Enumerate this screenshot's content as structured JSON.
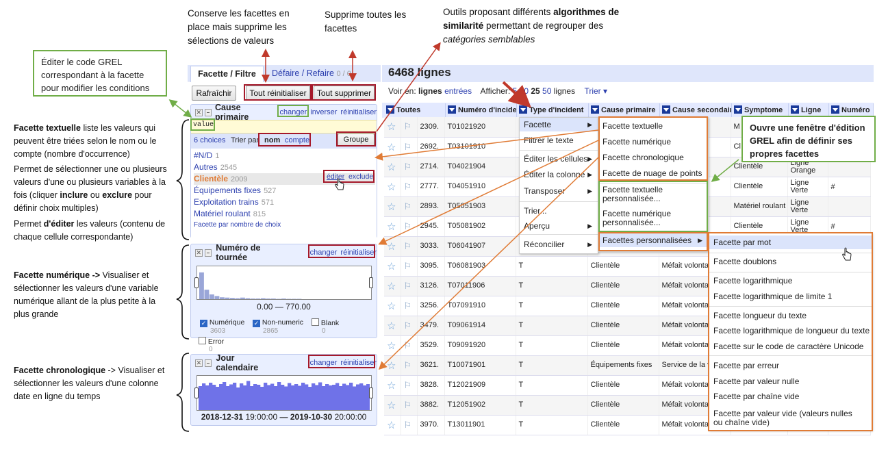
{
  "annotations": {
    "keep_facets": "Conserve les facettes en place mais supprime les sélections de valeurs",
    "remove_all": "Supprime toutes les facettes",
    "tools_1": "Outils proposant différents ",
    "tools_bold": "algorithmes de similarité",
    "tools_2": " permettant de regrouper des ",
    "tools_ital": "catégories semblables",
    "edit_grel": "Éditer le code GREL correspondant à la facette pour modifier les conditions",
    "text_bold": "Facette textuelle",
    "text_1": " liste les valeurs qui peuvent être triées selon le nom ou le compte (nombre d'occurrence)",
    "text_2a": "Permet de sélectionner une ou plusieurs valeurs d'une ou plusieurs variables à la fois (cliquer ",
    "text_2b": "inclure",
    "text_2c": " ou ",
    "text_2d": "exclure",
    "text_2e": " pour définir choix multiples)",
    "text_3a": "Permet ",
    "text_3b": "d'éditer",
    "text_3c": " les valeurs (contenu de chaque cellule correspondante)",
    "num_bold": "Facette numérique ->",
    "num_rest": " Visualiser et sélectionner les valeurs d'une variable numérique allant de la plus petite à la plus grande",
    "chrono_bold": "Facette chronologique",
    "chrono_rest": " ->  Visualiser et sélectionner les valeurs d'une colonne date en ligne du temps",
    "grel_window": "Ouvre une fenêtre d'édition GREL afin de définir ses propres facettes"
  },
  "tabs": {
    "facet": "Facette / Filtre",
    "undo": "Défaire / Refaire",
    "undo_count": "0 / 0"
  },
  "buttons": {
    "refresh": "Rafraîchir",
    "reset_all": "Tout réinitialiser",
    "remove_all": "Tout supprimer"
  },
  "facet1": {
    "title": "Cause primaire",
    "change": "changer",
    "invert": "inverser",
    "reset": "réinitialiser",
    "expr": "value",
    "choices": "6 choices",
    "sortby": "Trier par",
    "sort_name": "nom",
    "sort_count": "compte",
    "group": "Groupe",
    "items": [
      {
        "name": "#N/D",
        "count": "1"
      },
      {
        "name": "Autres",
        "count": "2545"
      },
      {
        "name": "Clientèle",
        "count": "2009"
      },
      {
        "name": "Équipements fixes",
        "count": "527"
      },
      {
        "name": "Exploitation trains",
        "count": "571"
      },
      {
        "name": "Matériel roulant",
        "count": "815"
      }
    ],
    "edit": "éditer",
    "exclude": "exclude",
    "by_count": "Facette par nombre de choix"
  },
  "facet2": {
    "title": "Numéro de tournée",
    "change": "changer",
    "reset": "réinitialiser",
    "range": "0.00 — 770.00",
    "numeric": "Numérique",
    "numeric_n": "3603",
    "nonnumeric": "Non-numeric",
    "nonnumeric_n": "2865",
    "blank": "Blank",
    "blank_n": "0",
    "error": "Error",
    "error_n": "0"
  },
  "facet3": {
    "title": "Jour calendaire",
    "change": "changer",
    "reset": "réinitialiser",
    "from": "2018-12-31",
    "from_t": "19:00:00",
    "dash": "—",
    "to": "2019-10-30",
    "to_t": "20:00:00"
  },
  "grid": {
    "rows_title": "6468 lignes",
    "view_label": "Voir en:",
    "view_rows": "lignes",
    "view_records": "entrées",
    "show_label": "Afficher:",
    "show_5": "5",
    "show_10": "10",
    "show_25": "25",
    "show_50": "50",
    "show_unit": "lignes",
    "sort": "Trier",
    "cols": [
      "Toutes",
      "Numéro d'incident",
      "Type d'incident",
      "Cause primaire",
      "Cause secondaire",
      "Symptome",
      "Ligne",
      "Numéro"
    ],
    "rows": [
      [
        "2309.",
        "T01021920",
        "",
        "",
        "oie",
        "M",
        ""
      ],
      [
        "2692.",
        "T03101910",
        "",
        "",
        "re",
        "Cl",
        ""
      ],
      [
        "2714.",
        "T04021904",
        "",
        "",
        "re",
        "Clientèle",
        "Ligne Orange"
      ],
      [
        "2777.",
        "T04051910",
        "",
        "",
        "re",
        "Clientèle",
        "Ligne Verte"
      ],
      [
        "2893.",
        "T05051903",
        "",
        "",
        "re",
        "Matériel roulant",
        "Ligne Verte"
      ],
      [
        "2945.",
        "T05081902",
        "",
        "",
        "re",
        "Clientèle",
        "Ligne Verte"
      ],
      [
        "3033.",
        "T06041907",
        "",
        "",
        "",
        "",
        ""
      ],
      [
        "3095.",
        "T06081903",
        "T",
        "Clientèle",
        "Méfait volontai",
        "",
        ""
      ],
      [
        "3126.",
        "T07011906",
        "T",
        "Clientèle",
        "Méfait volontai",
        "",
        ""
      ],
      [
        "3256.",
        "T07091910",
        "T",
        "Clientèle",
        "Méfait volontai",
        "",
        ""
      ],
      [
        "3479.",
        "T09061914",
        "T",
        "Clientèle",
        "Méfait volontai",
        "",
        ""
      ],
      [
        "3529.",
        "T09091920",
        "T",
        "Clientèle",
        "Méfait volontai",
        "",
        ""
      ],
      [
        "3621.",
        "T10071901",
        "T",
        "Équipements fixes",
        "Service de la v",
        "",
        ""
      ],
      [
        "3828.",
        "T12021909",
        "T",
        "Clientèle",
        "Méfait volontai",
        "",
        ""
      ],
      [
        "3882.",
        "T12051902",
        "T",
        "Clientèle",
        "Méfait volontai",
        "",
        ""
      ],
      [
        "3970.",
        "T13011901",
        "T",
        "Clientèle",
        "Méfait volontai",
        "",
        ""
      ]
    ],
    "hash": "#"
  },
  "menu1": [
    "Facette",
    "Filtrer le texte",
    "Éditer les cellules",
    "Éditer la colonne",
    "Transposer",
    "Trier...",
    "Aperçu",
    "Réconcilier"
  ],
  "menu2": [
    "Facette textuelle",
    "Facette numérique",
    "Facette chronologique",
    "Facette de nuage de points",
    "Facette textuelle personnalisée...",
    "Facette numérique personnalisée...",
    "Facettes personnalisées"
  ],
  "menu3": [
    "Facette par mot",
    "Facette doublons",
    "Facette logarithmique",
    "Facette logarithmique de limite 1",
    "Facette longueur du texte",
    "Facette logarithmique de longueur du texte",
    "Facette sur le code de caractère Unicode",
    "Facette par erreur",
    "Facette par valeur nulle",
    "Facette par chaîne vide",
    "Facette par valeur vide (valeurs nulles ou chaîne vide)"
  ],
  "histogram": [
    0.85,
    0.3,
    0.15,
    0.1,
    0.06,
    0.05,
    0.04,
    0.03,
    0.05,
    0.03,
    0.02,
    0.02,
    0.03,
    0.02,
    0.02,
    0.01,
    0.02,
    0.01,
    0.01,
    0.01
  ],
  "timeline": [
    0.7,
    0.78,
    0.72,
    0.8,
    0.74,
    0.68,
    0.76,
    0.82,
    0.7,
    0.75,
    0.8,
    0.66,
    0.78,
    0.72,
    0.85,
    0.7,
    0.76,
    0.74,
    0.68,
    0.8,
    0.73,
    0.77,
    0.7,
    0.82,
    0.74,
    0.69,
    0.79,
    0.72,
    0.76,
    0.71,
    0.8,
    0.75,
    0.68,
    0.78,
    0.73,
    0.81,
    0.7,
    0.76,
    0.72,
    0.74,
    0.79,
    0.7,
    0.77,
    0.73,
    0.8,
    0.69,
    0.75,
    0.78,
    0.72,
    0.76
  ]
}
